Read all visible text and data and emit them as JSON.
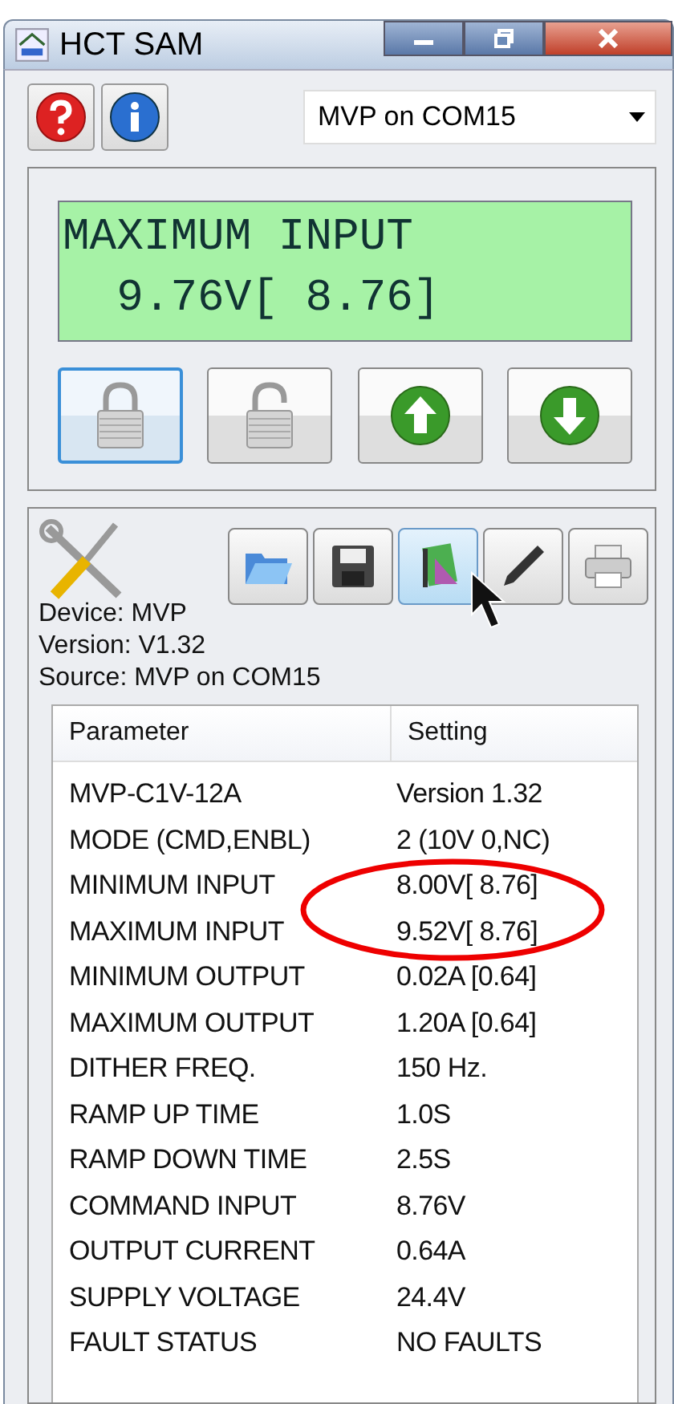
{
  "window": {
    "title": "HCT SAM"
  },
  "port_select": {
    "value": "MVP on COM15"
  },
  "display": {
    "lines": [
      "MAXIMUM INPUT",
      "  9.76V[ 8.76]"
    ]
  },
  "control_buttons": [
    {
      "kind": "lock",
      "selected": true
    },
    {
      "kind": "unlock",
      "selected": false
    },
    {
      "kind": "up",
      "selected": false
    },
    {
      "kind": "down",
      "selected": false
    }
  ],
  "toolbar": [
    {
      "kind": "open",
      "selected": false
    },
    {
      "kind": "save",
      "selected": false
    },
    {
      "kind": "chip",
      "selected": true
    },
    {
      "kind": "pen",
      "selected": false
    },
    {
      "kind": "print",
      "selected": false
    }
  ],
  "device_info": [
    "Device: MVP",
    "Version: V1.32",
    "Source: MVP on COM15"
  ],
  "table": {
    "columns": [
      "Parameter",
      "Setting"
    ],
    "rows": [
      [
        "MVP-C1V-12A",
        "Version 1.32"
      ],
      [
        "MODE (CMD,ENBL)",
        "2 (10V 0,NC)"
      ],
      [
        "MINIMUM INPUT",
        "8.00V[ 8.76]"
      ],
      [
        "MAXIMUM INPUT",
        "9.52V[ 8.76]"
      ],
      [
        "MINIMUM OUTPUT",
        "0.02A  [0.64]"
      ],
      [
        "MAXIMUM OUTPUT",
        "1.20A  [0.64]"
      ],
      [
        "DITHER FREQ.",
        "150 Hz."
      ],
      [
        "RAMP UP TIME",
        "1.0S"
      ],
      [
        "RAMP DOWN TIME",
        "2.5S"
      ],
      [
        "COMMAND INPUT",
        "8.76V"
      ],
      [
        "OUTPUT CURRENT",
        "0.64A"
      ],
      [
        "SUPPLY VOLTAGE",
        "24.4V"
      ],
      [
        "FAULT STATUS",
        "NO FAULTS"
      ]
    ]
  }
}
